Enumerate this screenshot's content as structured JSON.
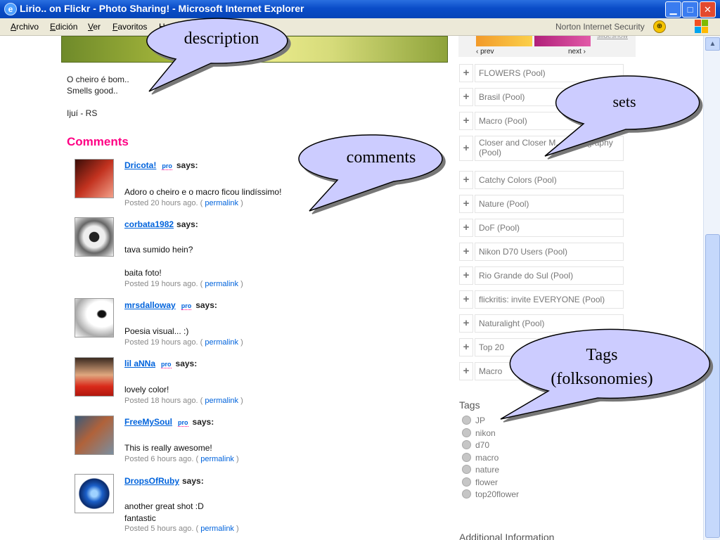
{
  "window": {
    "title": "Lirio.. on Flickr - Photo Sharing! - Microsoft Internet Explorer",
    "min": "▁",
    "max": "□",
    "close": "✕"
  },
  "menu": {
    "items": [
      {
        "label": "Archivo",
        "key": "A",
        "rest": "rchivo"
      },
      {
        "label": "Edición",
        "key": "E",
        "rest": "dición"
      },
      {
        "label": "Ver",
        "key": "V",
        "rest": "er"
      },
      {
        "label": "Favoritos",
        "key": "F",
        "rest": "avoritos"
      },
      {
        "label": "H",
        "key": "H",
        "rest": ""
      }
    ],
    "norton": "Norton Internet Security"
  },
  "photo_side": {
    "prev": "‹ prev",
    "next": "next ›",
    "slideshow": "slideshow"
  },
  "description": {
    "lines": [
      "O cheiro é bom..",
      "Smells good..",
      "Ijuí - RS"
    ]
  },
  "comments": {
    "heading": "Comments",
    "pro_label": "pro",
    "says": "says:",
    "permalink": "permalink",
    "items": [
      {
        "user": "Dricota!",
        "pro": true,
        "text": [
          "Adoro o cheiro e o macro ficou lindíssimo!"
        ],
        "posted_prefix": "Posted 20 hours ago. (",
        "posted_suffix": ")"
      },
      {
        "user": "corbata1982",
        "pro": false,
        "text": [
          "tava sumido hein?",
          "baita foto!"
        ],
        "posted_prefix": "Posted 19 hours ago. (",
        "posted_suffix": ")"
      },
      {
        "user": "mrsdalloway",
        "pro": true,
        "text": [
          "Poesia visual... :)"
        ],
        "posted_prefix": "Posted 19 hours ago. (",
        "posted_suffix": ")"
      },
      {
        "user": "lil aNNa",
        "pro": true,
        "text": [
          "lovely color!"
        ],
        "posted_prefix": "Posted 18 hours ago. (",
        "posted_suffix": ")"
      },
      {
        "user": "FreeMySoul",
        "pro": true,
        "text": [
          "This is really awesome!"
        ],
        "posted_prefix": "Posted 6 hours ago. (",
        "posted_suffix": ")"
      },
      {
        "user": "DropsOfRuby",
        "pro": false,
        "text": [
          "another great shot :D",
          "fantastic"
        ],
        "posted_prefix": "Posted 5 hours ago. (",
        "posted_suffix": ")"
      }
    ]
  },
  "pools": [
    "FLOWERS (Pool)",
    "Brasil (Pool)",
    "Macro (Pool)",
    "Closer and Closer M... Photography (Pool)",
    "Catchy Colors (Pool)",
    "Nature (Pool)",
    "DoF (Pool)",
    "Nikon D70 Users (Pool)",
    "Rio Grande do Sul (Pool)",
    "flickritis: invite EVERYONE (Pool)",
    "Naturalight (Pool)",
    "Top 20",
    "Macro"
  ],
  "tags": {
    "heading": "Tags",
    "items": [
      "JP",
      "nikon",
      "d70",
      "macro",
      "nature",
      "flower",
      "top20flower"
    ]
  },
  "additional_info": "Additional Information",
  "callouts": {
    "description": "description",
    "comments": "comments",
    "sets": "sets",
    "tags_line1": "Tags",
    "tags_line2": "(folksonomies)"
  },
  "colors": {
    "comments_heading": "#ff0084",
    "link": "#0063dc",
    "callout_fill": "#ccccff",
    "titlebar": "#0a4cc8"
  },
  "icons": {
    "ie": "ie-icon",
    "norton": "norton-icon",
    "windows_logo": "windows-logo-icon",
    "pool_add": "plus-icon",
    "tag_bullet": "tag-bullet-icon"
  }
}
